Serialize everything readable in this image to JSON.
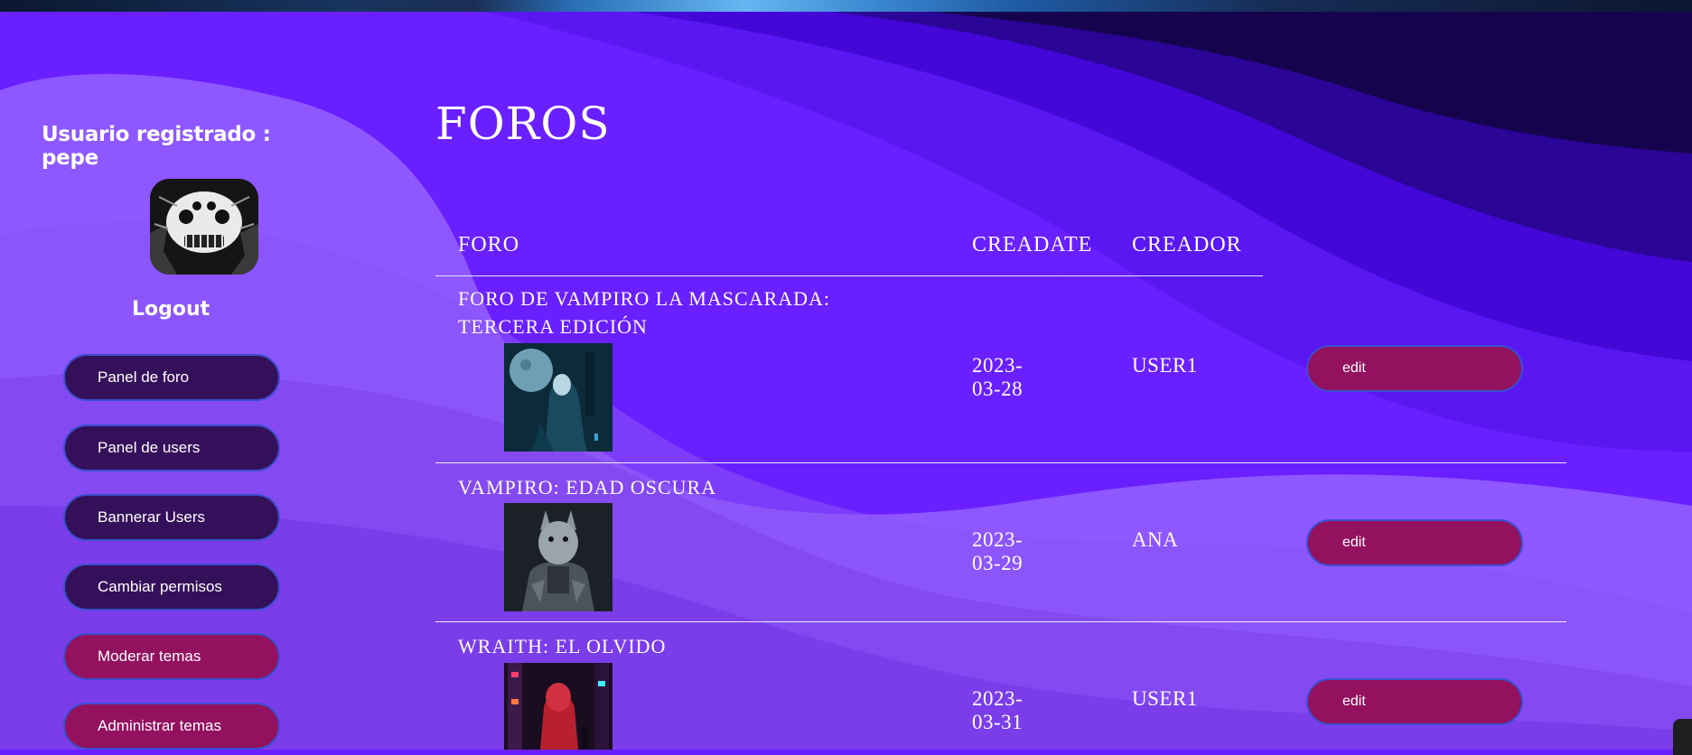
{
  "sidebar": {
    "user_title": "Usuario registrado : pepe",
    "logout": "Logout",
    "buttons": [
      {
        "label": "Panel de foro",
        "style": "dark"
      },
      {
        "label": "Panel de users",
        "style": "dark"
      },
      {
        "label": "Bannerar Users",
        "style": "dark"
      },
      {
        "label": "Cambiar permisos",
        "style": "dark"
      },
      {
        "label": "Moderar temas",
        "style": "pink"
      },
      {
        "label": "Administrar temas",
        "style": "pink"
      }
    ]
  },
  "main": {
    "title": "FOROS",
    "headers": {
      "foro": "FORO",
      "createdate": "CREADATE",
      "creador": "CREADOR"
    },
    "rows": [
      {
        "name": "FORO DE VAMPIRO LA MASCARADA: TERCERA EDICIÓN",
        "date": "2023-03-28",
        "creator": "USER1",
        "edit": "edit"
      },
      {
        "name": "VAMPIRO: EDAD OSCURA",
        "date": "2023-03-29",
        "creator": "ANA",
        "edit": "edit"
      },
      {
        "name": "WRAITH: EL OLVIDO",
        "date": "2023-03-31",
        "creator": "USER1",
        "edit": "edit"
      }
    ]
  },
  "colors": {
    "accent_dark": "#35105a",
    "accent_pink": "#93115f",
    "bg_purple": "#6a1fff"
  }
}
